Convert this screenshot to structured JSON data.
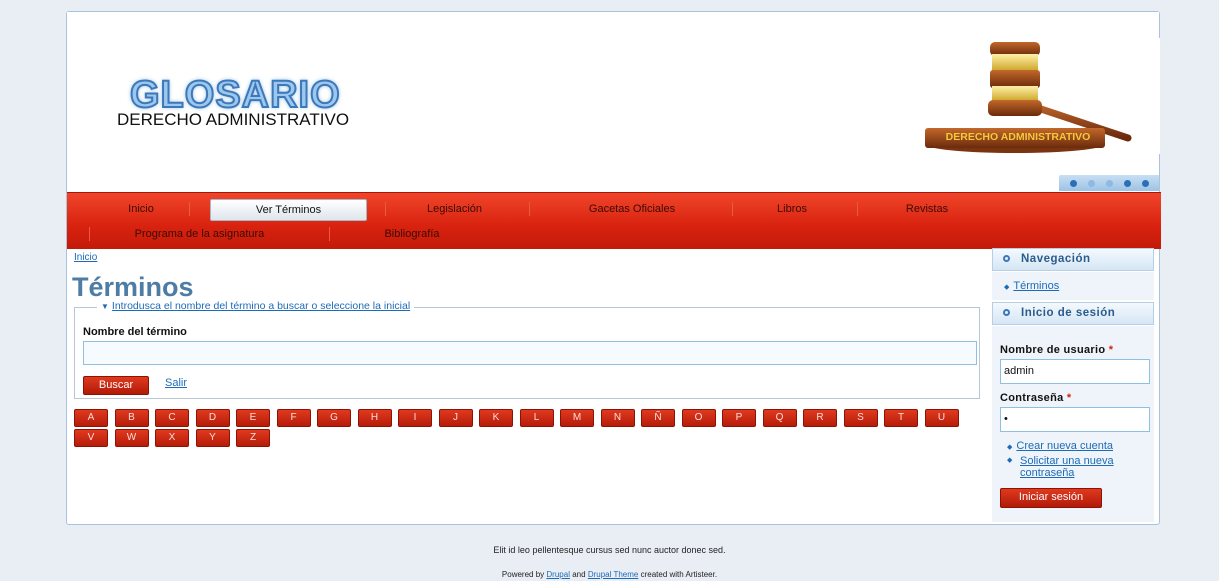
{
  "header": {
    "site_name": "GLOSARIO",
    "slogan": "DERECHO ADMINISTRATIVO",
    "image_banner": "DERECHO ADMINISTRATIVO",
    "slides": 5,
    "active_slide": 1
  },
  "nav": {
    "row1": [
      "Inicio",
      "Ver Términos",
      "Legislación",
      "Gacetas Oficiales",
      "Libros",
      "Revistas"
    ],
    "row2": [
      "Programa de la asignatura",
      "Bibliografía"
    ],
    "active": "Ver Términos"
  },
  "breadcrumb": "Inicio",
  "page_title": "Términos",
  "search": {
    "legend": "Introdusca el nombre del término a buscar o seleccione la inicial",
    "label": "Nombre del término",
    "value": "",
    "submit": "Buscar",
    "cancel": "Salir"
  },
  "letters": [
    "A",
    "B",
    "C",
    "D",
    "E",
    "F",
    "G",
    "H",
    "I",
    "J",
    "K",
    "L",
    "M",
    "N",
    "Ñ",
    "O",
    "P",
    "Q",
    "R",
    "S",
    "T",
    "U",
    "V",
    "W",
    "X",
    "Y",
    "Z"
  ],
  "sidebar": {
    "nav_title": "Navegación",
    "nav_link": "Términos",
    "login_title": "Inicio de sesión",
    "username_label": "Nombre de usuario",
    "username_value": "admin",
    "password_label": "Contraseña",
    "password_value": "•",
    "required_mark": "*",
    "create_account": "Crear nueva cuenta",
    "request_password": "Solicitar una nueva contraseña",
    "login_button": "Iniciar sesión"
  },
  "footer": {
    "line1": "Elit id leo pellentesque cursus sed nunc auctor donec sed.",
    "powered_prefix": "Powered by",
    "drupal": "Drupal",
    "and": "and",
    "drupal_theme": "Drupal Theme",
    "suffix": "created with Artisteer."
  },
  "colors": {
    "nav_red": "#d8220f",
    "link_blue": "#1d6bb8",
    "title_blue": "#4e7ca4"
  }
}
